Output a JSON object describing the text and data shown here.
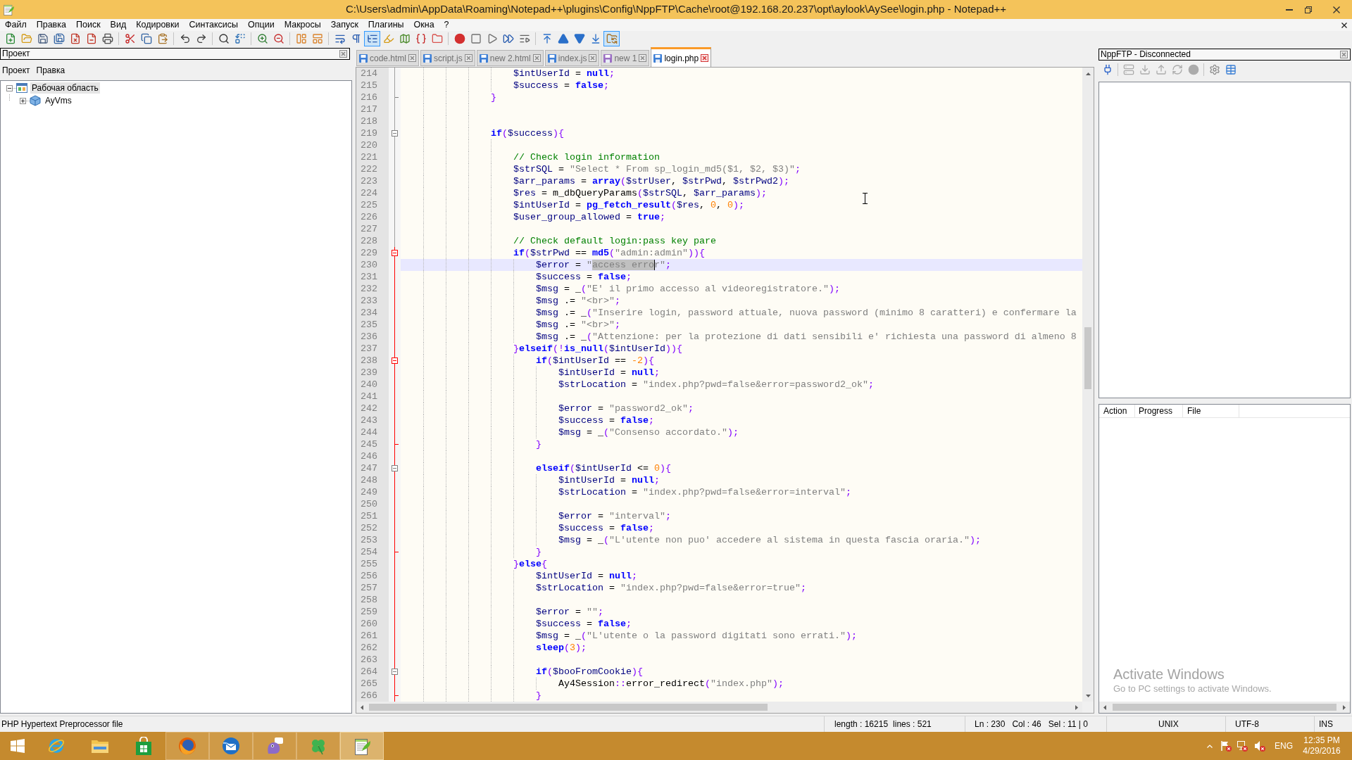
{
  "window": {
    "title": "C:\\Users\\admin\\AppData\\Roaming\\Notepad++\\plugins\\Config\\NppFTP\\Cache\\root@192.168.20.237\\opt\\aylook\\AySee\\login.php - Notepad++"
  },
  "menu": [
    "Файл",
    "Правка",
    "Поиск",
    "Вид",
    "Кодировки",
    "Синтаксисы",
    "Опции",
    "Макросы",
    "Запуск",
    "Плагины",
    "Окна",
    "?"
  ],
  "toolbar": [
    [
      {
        "kind": "new",
        "pressed": false
      },
      {
        "kind": "open",
        "pressed": false
      },
      {
        "kind": "save",
        "pressed": false
      },
      {
        "kind": "save_all",
        "pressed": false
      },
      {
        "kind": "close",
        "pressed": false
      },
      {
        "kind": "close_all",
        "pressed": false
      },
      {
        "kind": "print",
        "pressed": false
      }
    ],
    [
      {
        "kind": "cut",
        "pressed": false
      },
      {
        "kind": "copy",
        "pressed": false
      },
      {
        "kind": "paste",
        "pressed": false
      }
    ],
    [
      {
        "kind": "undo",
        "pressed": false
      },
      {
        "kind": "redo",
        "pressed": false
      }
    ],
    [
      {
        "kind": "find",
        "pressed": false
      },
      {
        "kind": "replace",
        "pressed": false
      }
    ],
    [
      {
        "kind": "zoom_in",
        "pressed": false
      },
      {
        "kind": "zoom_out",
        "pressed": false
      }
    ],
    [
      {
        "kind": "sync_vertical",
        "pressed": false
      },
      {
        "kind": "sync_horizontal",
        "pressed": false
      }
    ],
    [
      {
        "kind": "word_wrap",
        "pressed": false
      },
      {
        "kind": "all_chars",
        "pressed": false
      },
      {
        "kind": "indent_guide",
        "pressed": true
      },
      {
        "kind": "language",
        "pressed": false
      },
      {
        "kind": "doc_map",
        "pressed": false
      },
      {
        "kind": "function_list",
        "pressed": false
      },
      {
        "kind": "folder_workspace",
        "pressed": false
      }
    ],
    [
      {
        "kind": "record",
        "pressed": false
      },
      {
        "kind": "stop",
        "pressed": false
      },
      {
        "kind": "play",
        "pressed": false
      },
      {
        "kind": "play_multiple",
        "pressed": false
      },
      {
        "kind": "save_macro",
        "pressed": false
      }
    ],
    [
      {
        "kind": "first",
        "pressed": false
      },
      {
        "kind": "up",
        "pressed": false
      },
      {
        "kind": "down",
        "pressed": false
      },
      {
        "kind": "last",
        "pressed": false
      },
      {
        "kind": "ftp_window",
        "pressed": true
      }
    ]
  ],
  "project_panel": {
    "title": "Проект",
    "menu": [
      "Проект",
      "Правка"
    ],
    "tree": [
      {
        "label": "Рабочая область",
        "expanded": true,
        "selected": true,
        "children": [
          {
            "label": "AyVms",
            "expanded": false,
            "selected": false
          }
        ]
      }
    ]
  },
  "tabs": [
    {
      "label": "code.html",
      "color": "#3d7fd6",
      "selected": false
    },
    {
      "label": "script.js",
      "color": "#3d7fd6",
      "selected": false
    },
    {
      "label": "new 2.html",
      "color": "#3d7fd6",
      "selected": false
    },
    {
      "label": "index.js",
      "color": "#3d7fd6",
      "selected": false
    },
    {
      "label": "new 1",
      "color": "#9b6fc4",
      "selected": false
    },
    {
      "label": "login.php",
      "color": "#3d7fd6",
      "selected": true
    }
  ],
  "editor": {
    "lines": [
      {
        "number": "214",
        "in_block": false,
        "current": false,
        "code": [
          {
            "kind": "var",
            "text": "                    $intUserId"
          },
          {
            "kind": "txt",
            "text": " = "
          },
          {
            "kind": "kw",
            "text": "null"
          },
          {
            "kind": "op",
            "text": ";"
          }
        ]
      },
      {
        "number": "215",
        "in_block": false,
        "current": false,
        "code": [
          {
            "kind": "var",
            "text": "                    $success"
          },
          {
            "kind": "txt",
            "text": " = "
          },
          {
            "kind": "kw",
            "text": "false"
          },
          {
            "kind": "op",
            "text": ";"
          }
        ]
      },
      {
        "number": "216",
        "fold": {
          "kind": "end"
        },
        "in_block": false,
        "current": false,
        "code": [
          {
            "kind": "op",
            "text": "                }"
          }
        ]
      },
      {
        "number": "217",
        "in_block": false,
        "current": false
      },
      {
        "number": "218",
        "in_block": false,
        "current": false
      },
      {
        "number": "219",
        "fold": {
          "kind": "expanded"
        },
        "in_block": false,
        "current": false,
        "code": [
          {
            "kind": "kw",
            "text": "                if"
          },
          {
            "kind": "op",
            "text": "("
          },
          {
            "kind": "var",
            "text": "$success"
          },
          {
            "kind": "op",
            "text": "){"
          }
        ]
      },
      {
        "number": "220",
        "in_block": false,
        "current": false
      },
      {
        "number": "221",
        "in_block": false,
        "current": false,
        "code": [
          {
            "kind": "cmt",
            "text": "                    // Check login information"
          }
        ]
      },
      {
        "number": "222",
        "in_block": false,
        "current": false,
        "code": [
          {
            "kind": "var",
            "text": "                    $strSQL"
          },
          {
            "kind": "txt",
            "text": " = "
          },
          {
            "kind": "str",
            "text": "\"Select * From sp_login_md5($1, $2, $3)\""
          },
          {
            "kind": "op",
            "text": ";"
          }
        ]
      },
      {
        "number": "223",
        "in_block": false,
        "current": false,
        "code": [
          {
            "kind": "var",
            "text": "                    $arr_params"
          },
          {
            "kind": "txt",
            "text": " = "
          },
          {
            "kind": "kw",
            "text": "array"
          },
          {
            "kind": "op",
            "text": "("
          },
          {
            "kind": "var",
            "text": "$strUser"
          },
          {
            "kind": "txt",
            "text": ", "
          },
          {
            "kind": "var",
            "text": "$strPwd"
          },
          {
            "kind": "txt",
            "text": ", "
          },
          {
            "kind": "var",
            "text": "$strPwd2"
          },
          {
            "kind": "op",
            "text": ");"
          }
        ]
      },
      {
        "number": "224",
        "in_block": false,
        "current": false,
        "code": [
          {
            "kind": "var",
            "text": "                    $res"
          },
          {
            "kind": "txt",
            "text": " = "
          },
          {
            "kind": "txt",
            "text": "m_dbQueryParams"
          },
          {
            "kind": "op",
            "text": "("
          },
          {
            "kind": "var",
            "text": "$strSQL"
          },
          {
            "kind": "txt",
            "text": ", "
          },
          {
            "kind": "var",
            "text": "$arr_params"
          },
          {
            "kind": "op",
            "text": ");"
          }
        ]
      },
      {
        "number": "225",
        "in_block": false,
        "current": false,
        "code": [
          {
            "kind": "var",
            "text": "                    $intUserId"
          },
          {
            "kind": "txt",
            "text": " = "
          },
          {
            "kind": "kw",
            "text": "pg_fetch_result"
          },
          {
            "kind": "op",
            "text": "("
          },
          {
            "kind": "var",
            "text": "$res"
          },
          {
            "kind": "txt",
            "text": ", "
          },
          {
            "kind": "num",
            "text": "0"
          },
          {
            "kind": "txt",
            "text": ", "
          },
          {
            "kind": "num",
            "text": "0"
          },
          {
            "kind": "op",
            "text": ");"
          }
        ]
      },
      {
        "number": "226",
        "in_block": false,
        "current": false,
        "code": [
          {
            "kind": "var",
            "text": "                    $user_group_allowed"
          },
          {
            "kind": "txt",
            "text": " = "
          },
          {
            "kind": "kw",
            "text": "true"
          },
          {
            "kind": "op",
            "text": ";"
          }
        ]
      },
      {
        "number": "227",
        "in_block": false,
        "current": false
      },
      {
        "number": "228",
        "in_block": false,
        "current": false,
        "code": [
          {
            "kind": "cmt",
            "text": "                    // Check default login:pass key pare"
          }
        ]
      },
      {
        "number": "229",
        "fold": {
          "kind": "expanded-current"
        },
        "in_block": true,
        "current": false,
        "code": [
          {
            "kind": "kw",
            "text": "                    if"
          },
          {
            "kind": "op",
            "text": "("
          },
          {
            "kind": "var",
            "text": "$strPwd"
          },
          {
            "kind": "txt",
            "text": " == "
          },
          {
            "kind": "kw",
            "text": "md5"
          },
          {
            "kind": "op",
            "text": "("
          },
          {
            "kind": "str",
            "text": "\"admin:admin\""
          },
          {
            "kind": "op",
            "text": ")){"
          }
        ]
      },
      {
        "number": "230",
        "in_block": true,
        "current": true,
        "code": [
          {
            "kind": "var",
            "text": "                        $error"
          },
          {
            "kind": "txt",
            "text": " = "
          },
          {
            "kind": "str",
            "text": "\""
          },
          {
            "kind": "sel",
            "text": "access erro"
          },
          {
            "kind": "str",
            "text": "r\""
          },
          {
            "kind": "op",
            "text": ";"
          }
        ]
      },
      {
        "number": "231",
        "in_block": true,
        "current": false,
        "code": [
          {
            "kind": "var",
            "text": "                        $success"
          },
          {
            "kind": "txt",
            "text": " = "
          },
          {
            "kind": "kw",
            "text": "false"
          },
          {
            "kind": "op",
            "text": ";"
          }
        ]
      },
      {
        "number": "232",
        "in_block": true,
        "current": false,
        "code": [
          {
            "kind": "var",
            "text": "                        $msg"
          },
          {
            "kind": "txt",
            "text": " = "
          },
          {
            "kind": "txt",
            "text": "_"
          },
          {
            "kind": "op",
            "text": "("
          },
          {
            "kind": "str",
            "text": "\"E' il primo accesso al videoregistratore.\""
          },
          {
            "kind": "op",
            "text": ");"
          }
        ]
      },
      {
        "number": "233",
        "in_block": true,
        "current": false,
        "code": [
          {
            "kind": "var",
            "text": "                        $msg"
          },
          {
            "kind": "txt",
            "text": " .= "
          },
          {
            "kind": "str",
            "text": "\"<br>\""
          },
          {
            "kind": "op",
            "text": ";"
          }
        ]
      },
      {
        "number": "234",
        "in_block": true,
        "current": false,
        "code": [
          {
            "kind": "var",
            "text": "                        $msg"
          },
          {
            "kind": "txt",
            "text": " .= "
          },
          {
            "kind": "txt",
            "text": "_"
          },
          {
            "kind": "op",
            "text": "("
          },
          {
            "kind": "str",
            "text": "\"Inserire login, password attuale, nuova password (minimo 8 caratteri) e confermare la"
          }
        ]
      },
      {
        "number": "235",
        "in_block": true,
        "current": false,
        "code": [
          {
            "kind": "var",
            "text": "                        $msg"
          },
          {
            "kind": "txt",
            "text": " .= "
          },
          {
            "kind": "str",
            "text": "\"<br>\""
          },
          {
            "kind": "op",
            "text": ";"
          }
        ]
      },
      {
        "number": "236",
        "in_block": true,
        "current": false,
        "code": [
          {
            "kind": "var",
            "text": "                        $msg"
          },
          {
            "kind": "txt",
            "text": " .= "
          },
          {
            "kind": "txt",
            "text": "_"
          },
          {
            "kind": "op",
            "text": "("
          },
          {
            "kind": "str",
            "text": "\"Attenzione: per la protezione di dati sensibili e' richiesta una password di almeno 8"
          }
        ]
      },
      {
        "number": "237",
        "in_block": true,
        "current": false,
        "code": [
          {
            "kind": "op",
            "text": "                    }"
          },
          {
            "kind": "kw",
            "text": "elseif"
          },
          {
            "kind": "op",
            "text": "(!"
          },
          {
            "kind": "kw",
            "text": "is_null"
          },
          {
            "kind": "op",
            "text": "("
          },
          {
            "kind": "var",
            "text": "$intUserId"
          },
          {
            "kind": "op",
            "text": ")){"
          }
        ]
      },
      {
        "number": "238",
        "fold": {
          "kind": "expanded-current"
        },
        "in_block": true,
        "current": false,
        "code": [
          {
            "kind": "kw",
            "text": "                        if"
          },
          {
            "kind": "op",
            "text": "("
          },
          {
            "kind": "var",
            "text": "$intUserId"
          },
          {
            "kind": "txt",
            "text": " == "
          },
          {
            "kind": "num",
            "text": "-2"
          },
          {
            "kind": "op",
            "text": "){"
          }
        ]
      },
      {
        "number": "239",
        "in_block": true,
        "current": false,
        "code": [
          {
            "kind": "var",
            "text": "                            $intUserId"
          },
          {
            "kind": "txt",
            "text": " = "
          },
          {
            "kind": "kw",
            "text": "null"
          },
          {
            "kind": "op",
            "text": ";"
          }
        ]
      },
      {
        "number": "240",
        "in_block": true,
        "current": false,
        "code": [
          {
            "kind": "var",
            "text": "                            $strLocation"
          },
          {
            "kind": "txt",
            "text": " = "
          },
          {
            "kind": "str",
            "text": "\"index.php?pwd=false&error=password2_ok\""
          },
          {
            "kind": "op",
            "text": ";"
          }
        ]
      },
      {
        "number": "241",
        "in_block": true,
        "current": false
      },
      {
        "number": "242",
        "in_block": true,
        "current": false,
        "code": [
          {
            "kind": "var",
            "text": "                            $error"
          },
          {
            "kind": "txt",
            "text": " = "
          },
          {
            "kind": "str",
            "text": "\"password2_ok\""
          },
          {
            "kind": "op",
            "text": ";"
          }
        ]
      },
      {
        "number": "243",
        "in_block": true,
        "current": false,
        "code": [
          {
            "kind": "var",
            "text": "                            $success"
          },
          {
            "kind": "txt",
            "text": " = "
          },
          {
            "kind": "kw",
            "text": "false"
          },
          {
            "kind": "op",
            "text": ";"
          }
        ]
      },
      {
        "number": "244",
        "in_block": true,
        "current": false,
        "code": [
          {
            "kind": "var",
            "text": "                            $msg"
          },
          {
            "kind": "txt",
            "text": " = "
          },
          {
            "kind": "txt",
            "text": "_"
          },
          {
            "kind": "op",
            "text": "("
          },
          {
            "kind": "str",
            "text": "\"Consenso accordato.\""
          },
          {
            "kind": "op",
            "text": ");"
          }
        ]
      },
      {
        "number": "245",
        "fold": {
          "kind": "end"
        },
        "in_block": true,
        "current": false,
        "code": [
          {
            "kind": "op",
            "text": "                        }"
          }
        ]
      },
      {
        "number": "246",
        "in_block": true,
        "current": false
      },
      {
        "number": "247",
        "fold": {
          "kind": "expanded"
        },
        "in_block": true,
        "current": false,
        "code": [
          {
            "kind": "kw",
            "text": "                        elseif"
          },
          {
            "kind": "op",
            "text": "("
          },
          {
            "kind": "var",
            "text": "$intUserId"
          },
          {
            "kind": "txt",
            "text": " <= "
          },
          {
            "kind": "num",
            "text": "0"
          },
          {
            "kind": "op",
            "text": "){"
          }
        ]
      },
      {
        "number": "248",
        "in_block": true,
        "current": false,
        "code": [
          {
            "kind": "var",
            "text": "                            $intUserId"
          },
          {
            "kind": "txt",
            "text": " = "
          },
          {
            "kind": "kw",
            "text": "null"
          },
          {
            "kind": "op",
            "text": ";"
          }
        ]
      },
      {
        "number": "249",
        "in_block": true,
        "current": false,
        "code": [
          {
            "kind": "var",
            "text": "                            $strLocation"
          },
          {
            "kind": "txt",
            "text": " = "
          },
          {
            "kind": "str",
            "text": "\"index.php?pwd=false&error=interval\""
          },
          {
            "kind": "op",
            "text": ";"
          }
        ]
      },
      {
        "number": "250",
        "in_block": true,
        "current": false
      },
      {
        "number": "251",
        "in_block": true,
        "current": false,
        "code": [
          {
            "kind": "var",
            "text": "                            $error"
          },
          {
            "kind": "txt",
            "text": " = "
          },
          {
            "kind": "str",
            "text": "\"interval\""
          },
          {
            "kind": "op",
            "text": ";"
          }
        ]
      },
      {
        "number": "252",
        "in_block": true,
        "current": false,
        "code": [
          {
            "kind": "var",
            "text": "                            $success"
          },
          {
            "kind": "txt",
            "text": " = "
          },
          {
            "kind": "kw",
            "text": "false"
          },
          {
            "kind": "op",
            "text": ";"
          }
        ]
      },
      {
        "number": "253",
        "in_block": true,
        "current": false,
        "code": [
          {
            "kind": "var",
            "text": "                            $msg"
          },
          {
            "kind": "txt",
            "text": " = "
          },
          {
            "kind": "txt",
            "text": "_"
          },
          {
            "kind": "op",
            "text": "("
          },
          {
            "kind": "str",
            "text": "\"L'utente non puo' accedere al sistema in questa fascia oraria.\""
          },
          {
            "kind": "op",
            "text": ");"
          }
        ]
      },
      {
        "number": "254",
        "fold": {
          "kind": "end"
        },
        "in_block": true,
        "current": false,
        "code": [
          {
            "kind": "op",
            "text": "                        }"
          }
        ]
      },
      {
        "number": "255",
        "in_block": true,
        "current": false,
        "code": [
          {
            "kind": "op",
            "text": "                    }"
          },
          {
            "kind": "kw",
            "text": "else"
          },
          {
            "kind": "op",
            "text": "{"
          }
        ]
      },
      {
        "number": "256",
        "in_block": true,
        "current": false,
        "code": [
          {
            "kind": "var",
            "text": "                        $intUserId"
          },
          {
            "kind": "txt",
            "text": " = "
          },
          {
            "kind": "kw",
            "text": "null"
          },
          {
            "kind": "op",
            "text": ";"
          }
        ]
      },
      {
        "number": "257",
        "in_block": true,
        "current": false,
        "code": [
          {
            "kind": "var",
            "text": "                        $strLocation"
          },
          {
            "kind": "txt",
            "text": " = "
          },
          {
            "kind": "str",
            "text": "\"index.php?pwd=false&error=true\""
          },
          {
            "kind": "op",
            "text": ";"
          }
        ]
      },
      {
        "number": "258",
        "in_block": true,
        "current": false
      },
      {
        "number": "259",
        "in_block": true,
        "current": false,
        "code": [
          {
            "kind": "var",
            "text": "                        $error"
          },
          {
            "kind": "txt",
            "text": " = "
          },
          {
            "kind": "str",
            "text": "\"\""
          },
          {
            "kind": "op",
            "text": ";"
          }
        ]
      },
      {
        "number": "260",
        "in_block": true,
        "current": false,
        "code": [
          {
            "kind": "var",
            "text": "                        $success"
          },
          {
            "kind": "txt",
            "text": " = "
          },
          {
            "kind": "kw",
            "text": "false"
          },
          {
            "kind": "op",
            "text": ";"
          }
        ]
      },
      {
        "number": "261",
        "in_block": true,
        "current": false,
        "code": [
          {
            "kind": "var",
            "text": "                        $msg"
          },
          {
            "kind": "txt",
            "text": " = "
          },
          {
            "kind": "txt",
            "text": "_"
          },
          {
            "kind": "op",
            "text": "("
          },
          {
            "kind": "str",
            "text": "\"L'utente o la password digitati sono errati.\""
          },
          {
            "kind": "op",
            "text": ");"
          }
        ]
      },
      {
        "number": "262",
        "in_block": true,
        "current": false,
        "code": [
          {
            "kind": "kw",
            "text": "                        sleep"
          },
          {
            "kind": "op",
            "text": "("
          },
          {
            "kind": "num",
            "text": "3"
          },
          {
            "kind": "op",
            "text": ");"
          }
        ]
      },
      {
        "number": "263",
        "in_block": true,
        "current": false
      },
      {
        "number": "264",
        "fold": {
          "kind": "expanded"
        },
        "in_block": true,
        "current": false,
        "code": [
          {
            "kind": "kw",
            "text": "                        if"
          },
          {
            "kind": "op",
            "text": "("
          },
          {
            "kind": "var",
            "text": "$booFromCookie"
          },
          {
            "kind": "op",
            "text": "){"
          }
        ]
      },
      {
        "number": "265",
        "in_block": true,
        "current": false,
        "code": [
          {
            "kind": "txt",
            "text": "                            Ay4Session"
          },
          {
            "kind": "op",
            "text": "::"
          },
          {
            "kind": "txt",
            "text": "error_redirect"
          },
          {
            "kind": "op",
            "text": "("
          },
          {
            "kind": "str",
            "text": "\"index.php\""
          },
          {
            "kind": "op",
            "text": ");"
          }
        ]
      },
      {
        "number": "266",
        "fold": {
          "kind": "end"
        },
        "in_block": true,
        "current": false,
        "code": [
          {
            "kind": "op",
            "text": "                        }"
          }
        ]
      }
    ]
  },
  "ftp_panel": {
    "title": "NppFTP - Disconnected",
    "toolbar": [
      [
        {
          "kind": "connect",
          "disabled": false
        }
      ],
      [
        {
          "kind": "server",
          "disabled": true
        },
        {
          "kind": "download",
          "disabled": true
        },
        {
          "kind": "upload",
          "disabled": true
        },
        {
          "kind": "refresh",
          "disabled": true
        },
        {
          "kind": "abort",
          "disabled": true
        }
      ],
      [
        {
          "kind": "settings",
          "disabled": false
        },
        {
          "kind": "messages",
          "disabled": false
        }
      ]
    ],
    "queue_columns": [
      "Action",
      "Progress",
      "File"
    ]
  },
  "activation_notice": {
    "title": "Activate Windows",
    "text": "Go to PC settings to activate Windows."
  },
  "status_bar": {
    "file_type": "PHP Hypertext Preprocessor file",
    "length": "length : 16215",
    "lines": "lines : 521",
    "line": "Ln : 230",
    "column": "Col : 46",
    "selection": "Sel : 11 | 0",
    "eol": "UNIX",
    "encoding": "UTF-8",
    "mode": "INS"
  },
  "taskbar": {
    "apps": [
      {
        "kind": "e_ring",
        "running": false,
        "active": false
      },
      {
        "kind": "folder",
        "running": false,
        "active": false
      },
      {
        "kind": "bag",
        "running": false,
        "active": false
      },
      {
        "kind": "fox",
        "running": true,
        "active": false
      },
      {
        "kind": "mail_bird",
        "running": true,
        "active": false
      },
      {
        "kind": "chat_bird",
        "running": true,
        "active": false
      },
      {
        "kind": "clover",
        "running": true,
        "active": false
      },
      {
        "kind": "notepad",
        "running": true,
        "active": true
      }
    ],
    "language": "ENG",
    "time": "12:35 PM",
    "date": "4/29/2016"
  }
}
